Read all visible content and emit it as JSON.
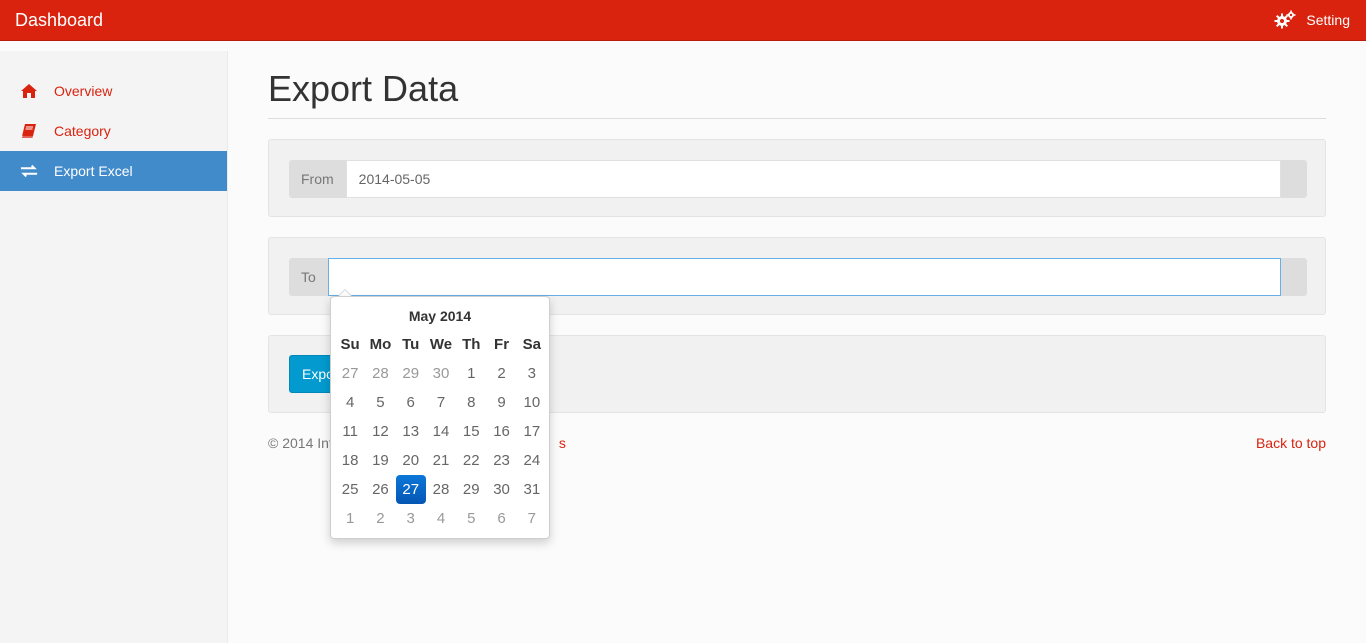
{
  "navbar": {
    "brand": "Dashboard",
    "setting_label": "Setting",
    "brand_color": "#d9230f"
  },
  "sidebar": {
    "items": [
      {
        "label": "Overview",
        "icon": "home-icon",
        "active": false
      },
      {
        "label": "Category",
        "icon": "book-icon",
        "active": false
      },
      {
        "label": "Export Excel",
        "icon": "transfer-icon",
        "active": true
      }
    ],
    "active_color": "#428bca"
  },
  "main": {
    "title": "Export Data",
    "from": {
      "label": "From",
      "value": "2014-05-05"
    },
    "to": {
      "label": "To",
      "value": ""
    },
    "export_button": "Expo"
  },
  "footer": {
    "copyright": "© 2014 Int",
    "copyright_link_fragment": "s",
    "back_to_top": "Back to top"
  },
  "datepicker": {
    "month_label": "May 2014",
    "weekdays": [
      "Su",
      "Mo",
      "Tu",
      "We",
      "Th",
      "Fr",
      "Sa"
    ],
    "weeks": [
      [
        {
          "d": "27",
          "t": "old"
        },
        {
          "d": "28",
          "t": "old"
        },
        {
          "d": "29",
          "t": "old"
        },
        {
          "d": "30",
          "t": "old"
        },
        {
          "d": "1",
          "t": "day"
        },
        {
          "d": "2",
          "t": "day"
        },
        {
          "d": "3",
          "t": "day"
        }
      ],
      [
        {
          "d": "4",
          "t": "day"
        },
        {
          "d": "5",
          "t": "day"
        },
        {
          "d": "6",
          "t": "day"
        },
        {
          "d": "7",
          "t": "day"
        },
        {
          "d": "8",
          "t": "day"
        },
        {
          "d": "9",
          "t": "day"
        },
        {
          "d": "10",
          "t": "day"
        }
      ],
      [
        {
          "d": "11",
          "t": "day"
        },
        {
          "d": "12",
          "t": "day"
        },
        {
          "d": "13",
          "t": "day"
        },
        {
          "d": "14",
          "t": "day"
        },
        {
          "d": "15",
          "t": "day"
        },
        {
          "d": "16",
          "t": "day"
        },
        {
          "d": "17",
          "t": "day"
        }
      ],
      [
        {
          "d": "18",
          "t": "day"
        },
        {
          "d": "19",
          "t": "day"
        },
        {
          "d": "20",
          "t": "day"
        },
        {
          "d": "21",
          "t": "day"
        },
        {
          "d": "22",
          "t": "day"
        },
        {
          "d": "23",
          "t": "day"
        },
        {
          "d": "24",
          "t": "day"
        }
      ],
      [
        {
          "d": "25",
          "t": "day"
        },
        {
          "d": "26",
          "t": "day"
        },
        {
          "d": "27",
          "t": "active"
        },
        {
          "d": "28",
          "t": "day"
        },
        {
          "d": "29",
          "t": "day"
        },
        {
          "d": "30",
          "t": "day"
        },
        {
          "d": "31",
          "t": "day"
        }
      ],
      [
        {
          "d": "1",
          "t": "new"
        },
        {
          "d": "2",
          "t": "new"
        },
        {
          "d": "3",
          "t": "new"
        },
        {
          "d": "4",
          "t": "new"
        },
        {
          "d": "5",
          "t": "new"
        },
        {
          "d": "6",
          "t": "new"
        },
        {
          "d": "7",
          "t": "new"
        }
      ]
    ],
    "selected_color": "#0865c4"
  }
}
